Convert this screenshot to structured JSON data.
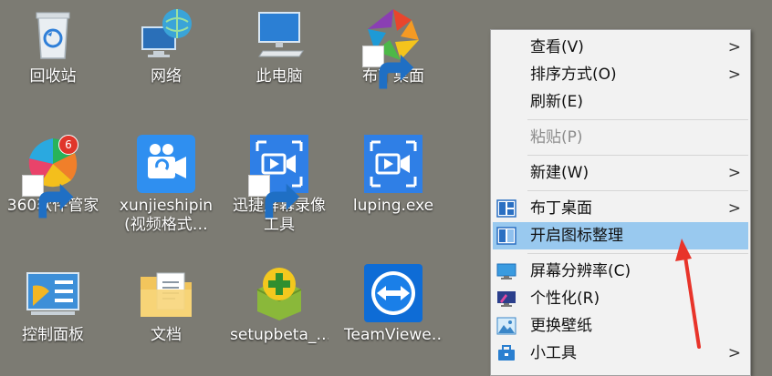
{
  "desktop": {
    "icons": [
      {
        "label": "回收站",
        "icon": "recycle-bin-icon"
      },
      {
        "label": "网络",
        "icon": "network-icon"
      },
      {
        "label": "此电脑",
        "icon": "this-pc-icon"
      },
      {
        "label": "布丁桌面",
        "icon": "budding-desktop-icon"
      },
      {
        "label": "360软件管家",
        "icon": "360-software-manager-icon",
        "badge": "6"
      },
      {
        "label": "xunjieshipin",
        "label2": "(视频格式…",
        "icon": "video-converter-icon"
      },
      {
        "label": "迅捷屏幕录像",
        "label2": "工具",
        "icon": "screen-recorder-icon"
      },
      {
        "label": "luping.exe",
        "icon": "luping-exe-icon"
      },
      {
        "label": "控制面板",
        "icon": "control-panel-icon"
      },
      {
        "label": "文档",
        "icon": "documents-folder-icon"
      },
      {
        "label": "setupbeta_…",
        "icon": "setup-beta-icon"
      },
      {
        "label": "TeamViewe…",
        "icon": "teamviewer-icon"
      }
    ]
  },
  "context_menu": {
    "items": {
      "view": "查看(V)",
      "sort": "排序方式(O)",
      "refresh": "刷新(E)",
      "paste": "粘贴(P)",
      "new": "新建(W)",
      "budding_desktop": "布丁桌面",
      "open_icon_organize": "开启图标整理",
      "resolution": "屏幕分辨率(C)",
      "personalize": "个性化(R)",
      "wallpaper": "更换壁纸",
      "gadgets": "小工具"
    },
    "submenu_arrow": ">"
  },
  "colors": {
    "desktop_bg": "#7c7b73",
    "menu_bg": "#f2f2f2",
    "highlight": "#99c9ef",
    "annotation_arrow": "#e8342a"
  }
}
